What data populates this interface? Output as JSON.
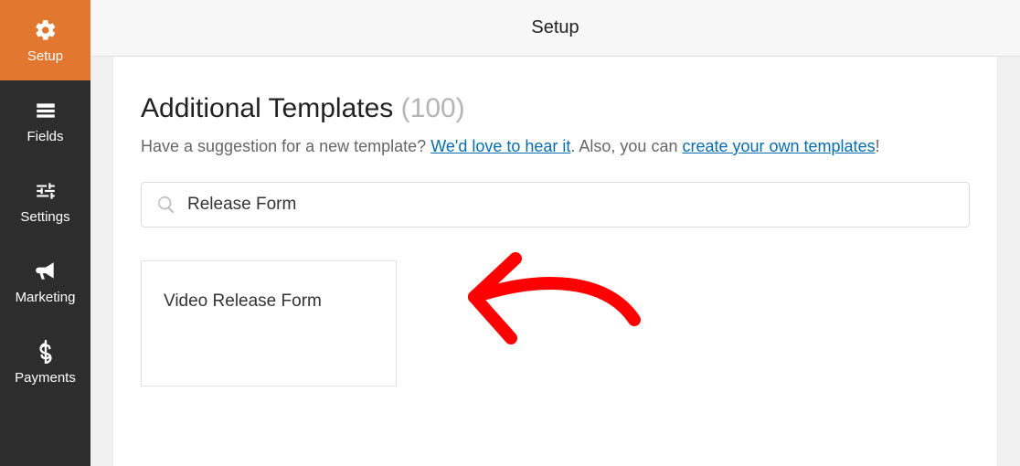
{
  "topbar": {
    "title": "Setup"
  },
  "sidebar": {
    "items": [
      {
        "label": "Setup"
      },
      {
        "label": "Fields"
      },
      {
        "label": "Settings"
      },
      {
        "label": "Marketing"
      },
      {
        "label": "Payments"
      }
    ]
  },
  "panel": {
    "heading": "Additional Templates",
    "count": "(100)",
    "subtext_pre": "Have a suggestion for a new template? ",
    "link1": "We'd love to hear it",
    "subtext_mid": ". Also, you can ",
    "link2": "create your own templates",
    "subtext_post": "!",
    "search_value": "Release Form",
    "template_title": "Video Release Form"
  }
}
